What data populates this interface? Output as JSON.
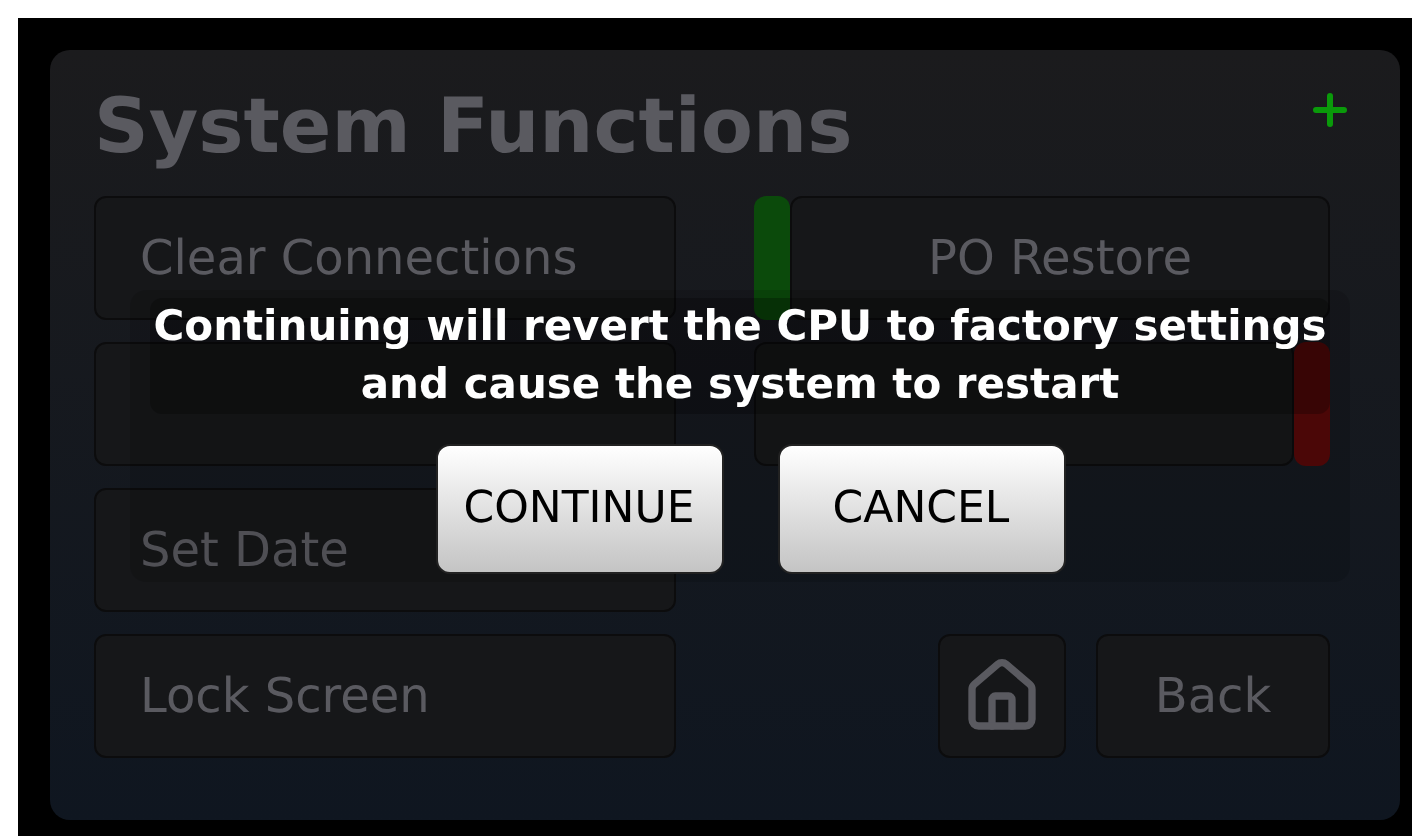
{
  "title": "System Functions",
  "buttons": [
    {
      "label": "Clear Connections"
    },
    {
      "label": "PO Restore",
      "color": "#0b4a0b",
      "kind": "leading"
    },
    {
      "kind": "blank"
    },
    {
      "color": "#560909",
      "kind": "trailing"
    },
    {
      "label": "Set Date"
    },
    {
      "kind": "spacer"
    },
    {
      "label": "Lock Screen"
    }
  ],
  "back": "Back",
  "dialog": {
    "message": "Continuing will revert the CPU to factory settings and cause the system to restart",
    "actions": [
      "CONTINUE",
      "CANCEL"
    ]
  }
}
